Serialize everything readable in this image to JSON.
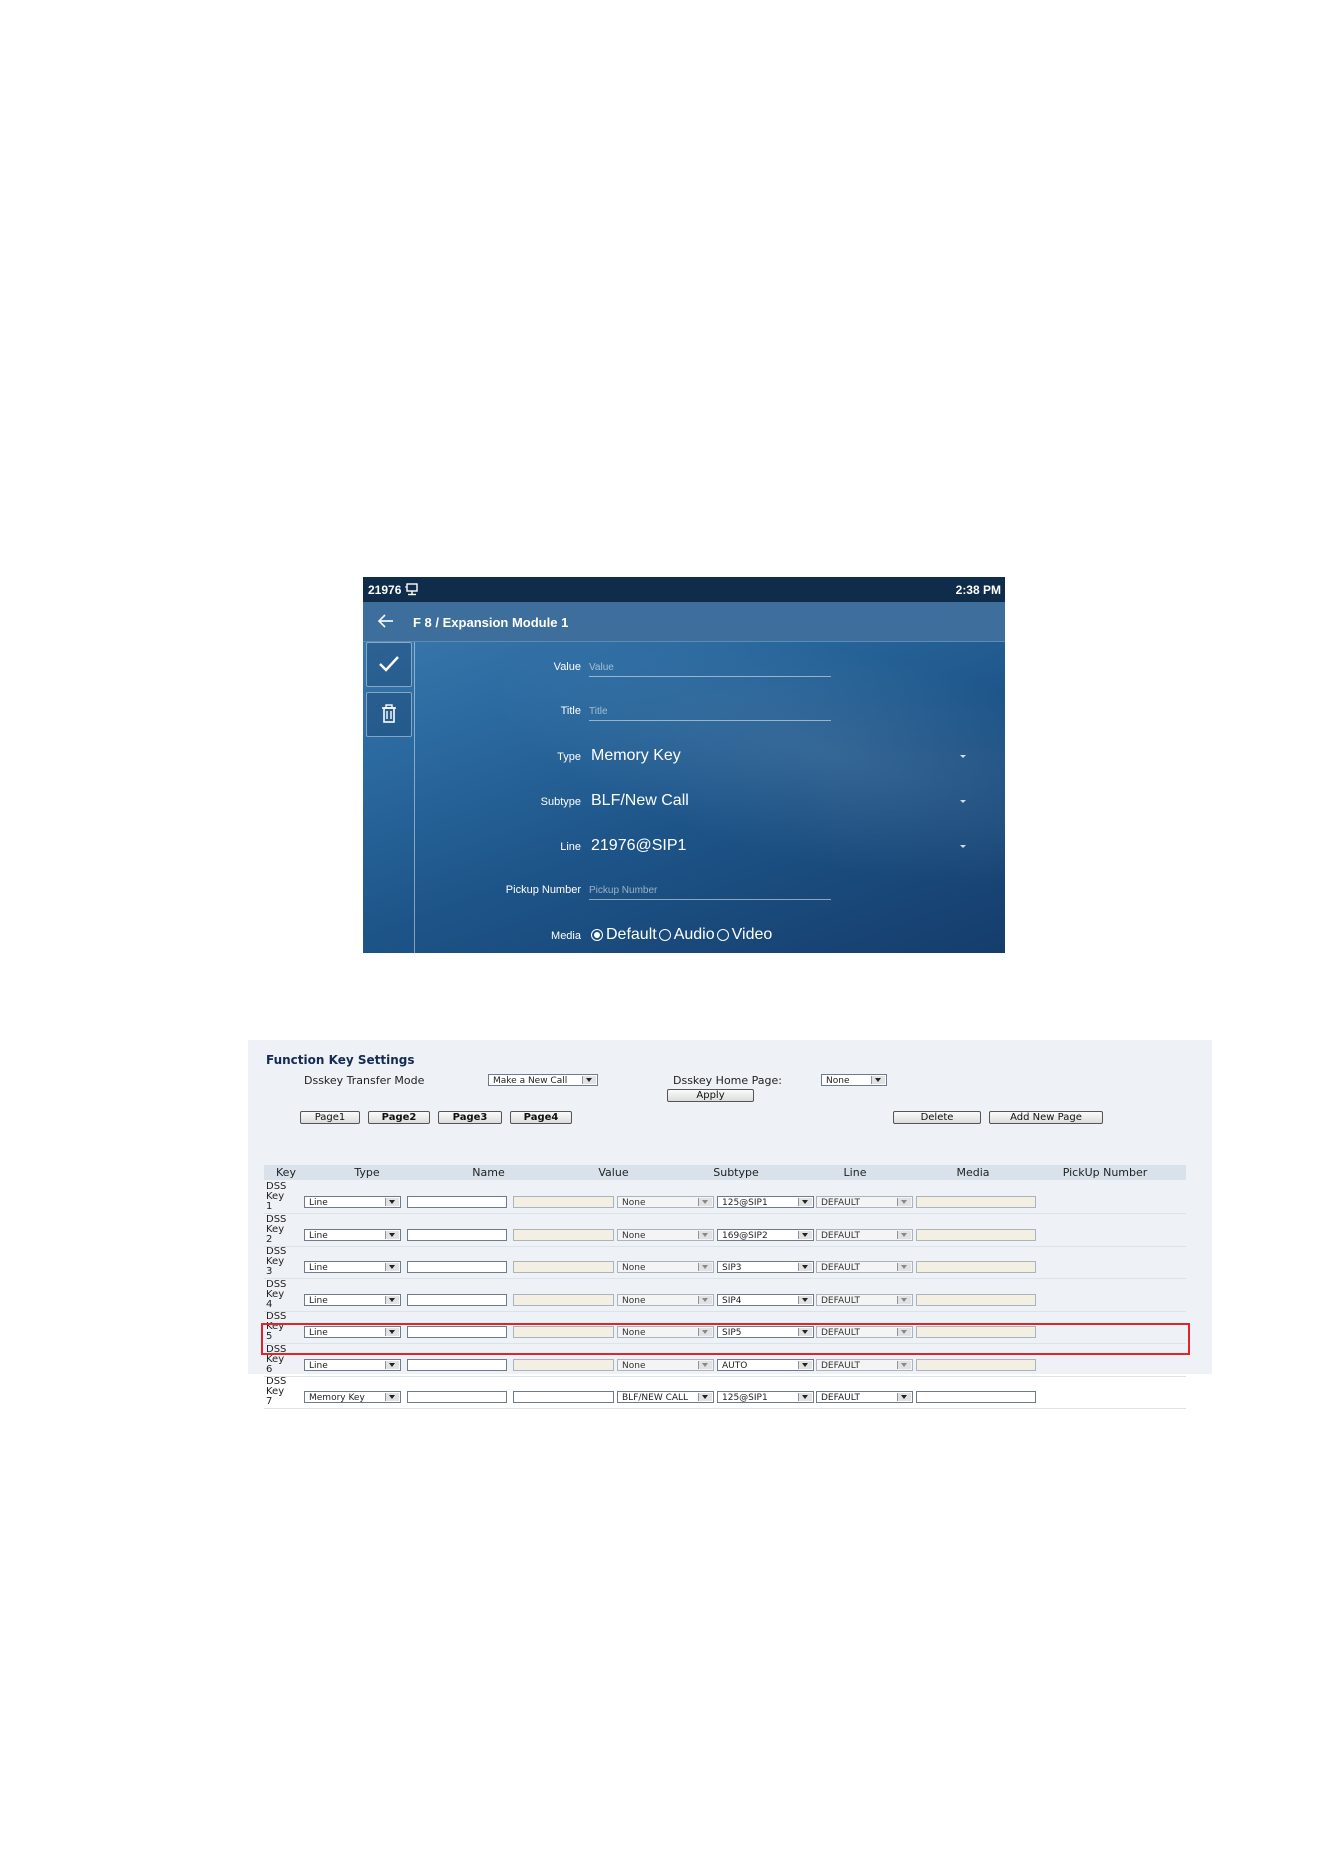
{
  "phone": {
    "status": {
      "extension": "21976",
      "network_icon": "network-icon",
      "time": "2:38 PM"
    },
    "header": {
      "back_icon": "back-arrow-icon",
      "title": "F 8 / Expansion Module 1"
    },
    "sidebar": {
      "confirm_icon": "checkmark-icon",
      "delete_icon": "trash-icon"
    },
    "fields": {
      "value": {
        "label": "Value",
        "placeholder": "Value"
      },
      "title": {
        "label": "Title",
        "placeholder": "Title"
      },
      "type": {
        "label": "Type",
        "value": "Memory Key"
      },
      "subtype": {
        "label": "Subtype",
        "value": "BLF/New Call"
      },
      "line": {
        "label": "Line",
        "value": "21976@SIP1"
      },
      "pickup": {
        "label": "Pickup Number",
        "placeholder": "Pickup Number"
      },
      "media": {
        "label": "Media",
        "options": [
          "Default",
          "Audio",
          "Video"
        ],
        "selected": "Default"
      }
    },
    "colors": {
      "status_bar": "#0f2c4a",
      "title_bar": "#3e6f9c",
      "background": "#1d5488"
    }
  },
  "web": {
    "section_title": "Function Key Settings",
    "transfer_mode": {
      "label": "Dsskey Transfer Mode",
      "value": "Make a New Call"
    },
    "home_page": {
      "label": "Dsskey Home Page:",
      "value": "None"
    },
    "apply_label": "Apply",
    "pages": [
      "Page1",
      "Page2",
      "Page3",
      "Page4"
    ],
    "delete_label": "Delete",
    "add_page_label": "Add New Page",
    "columns": [
      "Key",
      "Type",
      "Name",
      "Value",
      "Subtype",
      "Line",
      "Media",
      "PickUp Number"
    ],
    "rows": [
      {
        "key": [
          "DSS",
          "Key",
          "1"
        ],
        "type": "Line",
        "subtype": "None",
        "line": "125@SIP1",
        "media": "DEFAULT"
      },
      {
        "key": [
          "DSS",
          "Key",
          "2"
        ],
        "type": "Line",
        "subtype": "None",
        "line": "169@SIP2",
        "media": "DEFAULT"
      },
      {
        "key": [
          "DSS",
          "Key",
          "3"
        ],
        "type": "Line",
        "subtype": "None",
        "line": "SIP3",
        "media": "DEFAULT"
      },
      {
        "key": [
          "DSS",
          "Key",
          "4"
        ],
        "type": "Line",
        "subtype": "None",
        "line": "SIP4",
        "media": "DEFAULT"
      },
      {
        "key": [
          "DSS",
          "Key",
          "5"
        ],
        "type": "Line",
        "subtype": "None",
        "line": "SIP5",
        "media": "DEFAULT"
      },
      {
        "key": [
          "DSS",
          "Key",
          "6"
        ],
        "type": "Line",
        "subtype": "None",
        "line": "AUTO",
        "media": "DEFAULT"
      },
      {
        "key": [
          "DSS",
          "Key",
          "7"
        ],
        "type": "Memory Key",
        "subtype": "BLF/NEW CALL",
        "line": "125@SIP1",
        "media": "DEFAULT"
      }
    ],
    "colors": {
      "highlight": "#e0242c",
      "header_bg": "#d9e2ea",
      "title": "#142a52"
    }
  }
}
